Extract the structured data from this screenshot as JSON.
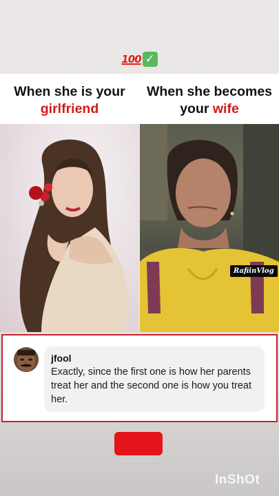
{
  "top_emoji": {
    "hundred": "100",
    "check": "✓"
  },
  "titles": {
    "left_line1": "When she is your",
    "left_line2": "girlfriend",
    "right_line1": "When she becomes",
    "right_line2_prefix": "your ",
    "right_line2_highlight": "wife"
  },
  "photos": {
    "right_watermark": "RafiinVlog"
  },
  "comment": {
    "username": "jfool",
    "text": "Exactly, since the first one is how her parents treat her and the second one is how you treat her."
  },
  "watermark": {
    "app": "InShOt"
  },
  "colors": {
    "accent_red": "#d11a1a",
    "frame_red": "#c2252c",
    "button_red": "#e4141b"
  }
}
